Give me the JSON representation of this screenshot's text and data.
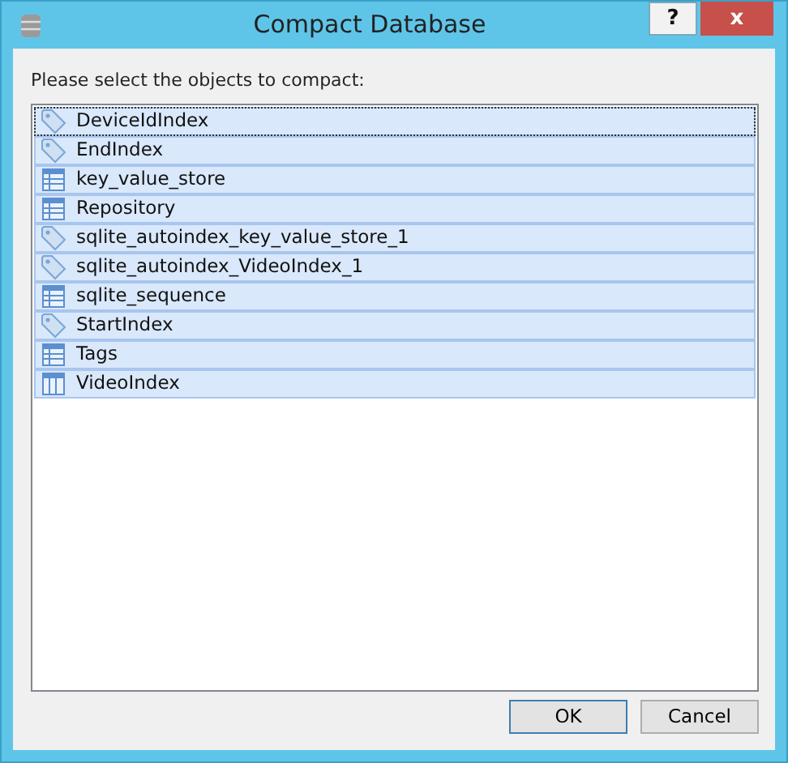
{
  "window": {
    "title": "Compact Database",
    "help_button": "?",
    "close_button": "x"
  },
  "prompt": "Please select the objects to compact:",
  "objects": [
    {
      "name": "DeviceIdIndex",
      "kind": "index",
      "selected": true,
      "focused": true
    },
    {
      "name": "EndIndex",
      "kind": "index",
      "selected": true,
      "focused": false
    },
    {
      "name": "key_value_store",
      "kind": "table",
      "selected": true,
      "focused": false
    },
    {
      "name": "Repository",
      "kind": "table",
      "selected": true,
      "focused": false
    },
    {
      "name": "sqlite_autoindex_key_value_store_1",
      "kind": "index",
      "selected": true,
      "focused": false
    },
    {
      "name": "sqlite_autoindex_VideoIndex_1",
      "kind": "index",
      "selected": true,
      "focused": false
    },
    {
      "name": "sqlite_sequence",
      "kind": "table",
      "selected": true,
      "focused": false
    },
    {
      "name": "StartIndex",
      "kind": "index",
      "selected": true,
      "focused": false
    },
    {
      "name": "Tags",
      "kind": "table",
      "selected": true,
      "focused": false
    },
    {
      "name": "VideoIndex",
      "kind": "view",
      "selected": true,
      "focused": false
    }
  ],
  "buttons": [
    {
      "label": "OK",
      "default": true
    },
    {
      "label": "Cancel",
      "default": false
    }
  ]
}
